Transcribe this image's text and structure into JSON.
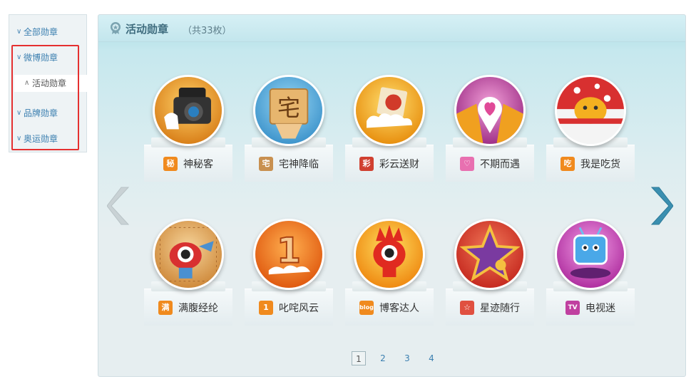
{
  "sidebar": {
    "items": [
      {
        "label": "全部勋章",
        "chevron": "∨"
      },
      {
        "label": "微博勋章",
        "chevron": "∨"
      },
      {
        "label": "活动勋章",
        "chevron": "∧"
      },
      {
        "label": "品牌勋章",
        "chevron": "∨"
      },
      {
        "label": "奥运勋章",
        "chevron": "∨"
      }
    ],
    "active_index": 2
  },
  "panel": {
    "title": "活动勋章",
    "count": "（共33枚）",
    "title_icon": "medal-icon"
  },
  "badges": [
    {
      "name": "神秘客",
      "mini": "秘",
      "mini_color": "#f08a1e",
      "bg": "#f0a030",
      "icon": "mystery-camera-icon"
    },
    {
      "name": "宅神降临",
      "mini": "宅",
      "mini_color": "#c89050",
      "bg": "#5bb0e0",
      "icon": "otaku-icon"
    },
    {
      "name": "彩云送财",
      "mini": "彩",
      "mini_color": "#d04030",
      "bg": "#f4a820",
      "icon": "lucky-cloud-icon"
    },
    {
      "name": "不期而遇",
      "mini": "♡",
      "mini_color": "#e870b0",
      "bg": "#c050a0",
      "icon": "heart-pin-icon"
    },
    {
      "name": "我是吃货",
      "mini": "吃",
      "mini_color": "#f08a1e",
      "bg": "#e04040",
      "icon": "foodie-icon"
    },
    {
      "name": "满腹经纶",
      "mini": "满",
      "mini_color": "#f08a1e",
      "bg": "#e8a048",
      "icon": "scholar-icon"
    },
    {
      "name": "叱咤风云",
      "mini": "1",
      "mini_color": "#f08a1e",
      "bg": "#f07820",
      "icon": "number-one-icon"
    },
    {
      "name": "博客达人",
      "mini": "blog",
      "mini_color": "#f08a1e",
      "bg": "#f4a820",
      "icon": "blogger-icon"
    },
    {
      "name": "星迹随行",
      "mini": "☆",
      "mini_color": "#e05040",
      "bg": "#e04a3a",
      "icon": "star-trail-icon"
    },
    {
      "name": "电视迷",
      "mini": "TV",
      "mini_color": "#c040a0",
      "bg": "#d060c0",
      "icon": "tv-fan-icon"
    }
  ],
  "pagination": {
    "pages": [
      "1",
      "2",
      "3",
      "4"
    ],
    "current": "1"
  },
  "nav": {
    "prev_icon": "chevron-left-icon",
    "next_icon": "chevron-right-icon"
  }
}
